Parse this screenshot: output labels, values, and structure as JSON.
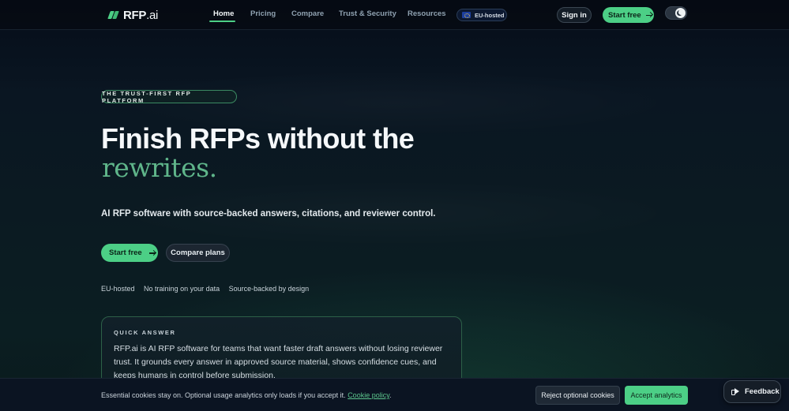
{
  "brand": {
    "logo_text": "RFP",
    "logo_suffix": ".ai",
    "accent_color": "#4ccf86",
    "logo_icon": "rfp-logo-icon"
  },
  "nav": {
    "links": [
      {
        "label": "Home",
        "active": true
      },
      {
        "label": "Pricing",
        "active": false
      },
      {
        "label": "Compare",
        "active": false
      },
      {
        "label": "Trust & Security",
        "active": false
      },
      {
        "label": "Resources",
        "active": false
      }
    ],
    "eu_badge": "EU-hosted",
    "eu_icon": "eu-flag-icon",
    "sign_in": "Sign in",
    "start_free": "Start free",
    "theme_toggle_icon": "moon-icon",
    "theme_mode": "dark"
  },
  "hero": {
    "eyebrow": "THE TRUST-FIRST RFP PLATFORM",
    "headline_line1": "Finish RFPs without the",
    "headline_line2": "rewrites.",
    "subtitle": "AI RFP software with source-backed answers, citations, and reviewer control.",
    "primary_cta": "Start free",
    "secondary_cta": "Compare plans",
    "trust_points": [
      "EU-hosted",
      "No training on your data",
      "Source-backed by design"
    ]
  },
  "quick_answer": {
    "label": "QUICK ANSWER",
    "text": "RFP.ai is AI RFP software for teams that want faster draft answers without losing reviewer trust. It grounds every answer in approved source material, shows confidence cues, and keeps humans in control before submission."
  },
  "cookie_bar": {
    "text": "Essential cookies stay on. Optional usage analytics only loads if you accept it.",
    "link_label": "Cookie policy",
    "link_suffix": ".",
    "reject_label": "Reject optional cookies",
    "accept_label": "Accept analytics"
  },
  "feedback": {
    "label": "Feedback",
    "icon": "megaphone-icon"
  }
}
